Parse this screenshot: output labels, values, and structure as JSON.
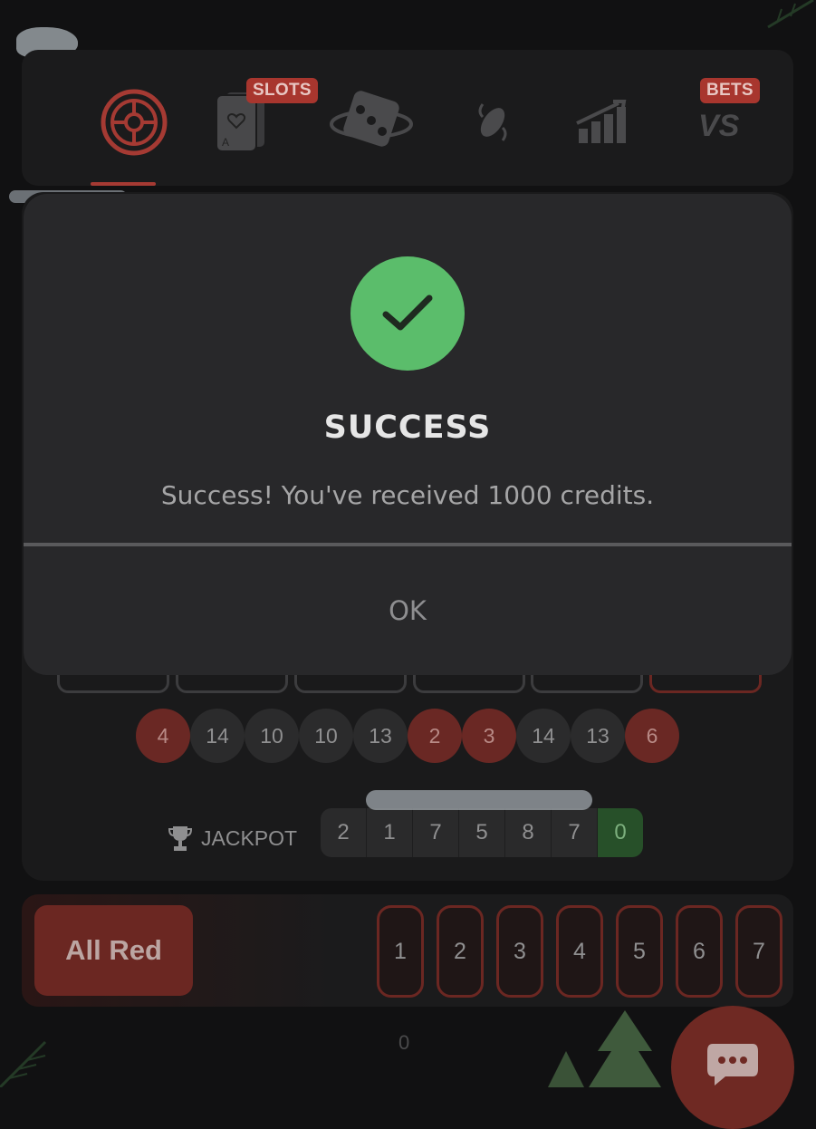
{
  "nav": {
    "items": [
      {
        "name": "roulette",
        "badge": ""
      },
      {
        "name": "slots",
        "badge": "SLOTS"
      },
      {
        "name": "dice",
        "badge": ""
      },
      {
        "name": "coinflip",
        "badge": ""
      },
      {
        "name": "crash",
        "badge": ""
      },
      {
        "name": "versus",
        "badge": "BETS"
      }
    ],
    "active_index": 0
  },
  "modal": {
    "title": "SUCCESS",
    "message": "Success! You've received 1000 credits.",
    "ok_label": "OK",
    "icon": "check-icon"
  },
  "history": {
    "balls": [
      {
        "value": "4",
        "color": "red"
      },
      {
        "value": "14",
        "color": "dark"
      },
      {
        "value": "10",
        "color": "dark"
      },
      {
        "value": "10",
        "color": "dark"
      },
      {
        "value": "13",
        "color": "dark"
      },
      {
        "value": "2",
        "color": "red"
      },
      {
        "value": "3",
        "color": "red"
      },
      {
        "value": "14",
        "color": "dark"
      },
      {
        "value": "13",
        "color": "dark"
      },
      {
        "value": "6",
        "color": "red"
      }
    ]
  },
  "jackpot": {
    "label": "JACKPOT",
    "digits": [
      "2",
      "1",
      "7",
      "5",
      "8",
      "7",
      "0"
    ]
  },
  "bet_row": {
    "all_red_label": "All Red",
    "numbers": [
      "1",
      "2",
      "3",
      "4",
      "5",
      "6",
      "7"
    ]
  },
  "footer": {
    "counter": "0"
  },
  "colors": {
    "success_green": "#5bbd6b",
    "accent_red": "#a8362e",
    "modal_bg": "#28282a"
  }
}
